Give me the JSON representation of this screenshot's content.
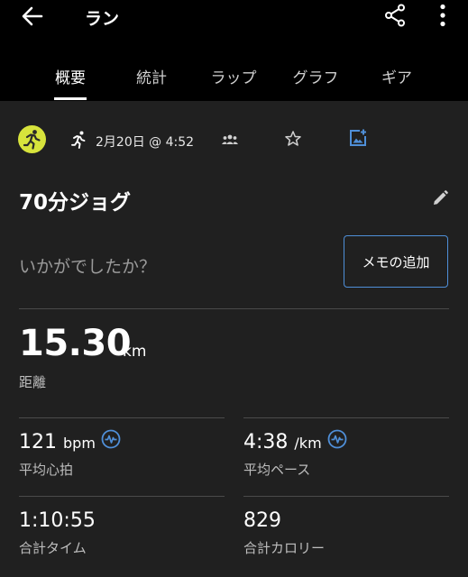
{
  "header": {
    "title": "ラン",
    "back_icon": "back-arrow-icon",
    "share_icon": "share-icon",
    "more_icon": "more-vert-icon"
  },
  "tabs": [
    {
      "label": "概要",
      "active": true
    },
    {
      "label": "統計",
      "active": false
    },
    {
      "label": "ラップ",
      "active": false
    },
    {
      "label": "グラフ",
      "active": false
    },
    {
      "label": "ギア",
      "active": false
    }
  ],
  "meta": {
    "activity_type_icon": "runner-icon",
    "datetime": "2月20日 @ 4:52",
    "badge_color": "#d7e33c",
    "accent_color": "#4f8fd8"
  },
  "activity": {
    "name": "70分ジョグ"
  },
  "feedback": {
    "prompt": "いかがでしたか？",
    "add_memo_label": "メモの追加"
  },
  "distance": {
    "value": "15.30",
    "unit": "km",
    "label": "距離"
  },
  "stats": {
    "avg_hr": {
      "value": "121",
      "unit": "bpm",
      "label": "平均心拍"
    },
    "avg_pace": {
      "value": "4:38",
      "unit": "/km",
      "label": "平均ペース"
    },
    "total_time": {
      "value": "1:10:55",
      "label": "合計タイム"
    },
    "total_calories": {
      "value": "829",
      "label": "合計カロリー"
    }
  }
}
